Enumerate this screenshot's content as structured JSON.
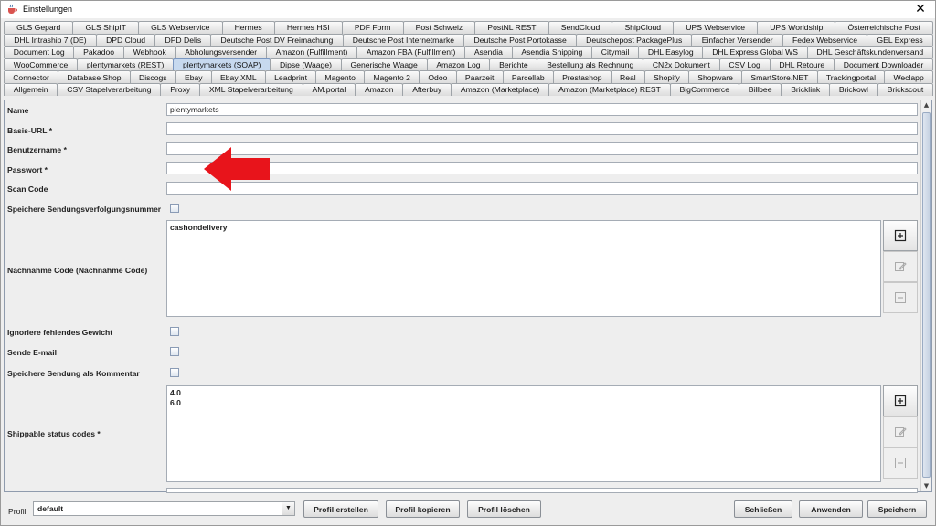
{
  "window": {
    "title": "Einstellungen",
    "close_glyph": "✕",
    "icon": "java-cup-icon"
  },
  "tabs": {
    "rows": [
      [
        "GLS Gepard",
        "GLS ShipIT",
        "GLS Webservice",
        "Hermes",
        "Hermes HSI",
        "PDF Form",
        "Post Schweiz",
        "PostNL REST",
        "SendCloud",
        "ShipCloud",
        "UPS Webservice",
        "UPS Worldship",
        "Österreichische Post"
      ],
      [
        "DHL Intraship 7 (DE)",
        "DPD Cloud",
        "DPD Delis",
        "Deutsche Post DV Freimachung",
        "Deutsche Post Internetmarke",
        "Deutsche Post Portokasse",
        "Deutschepost PackagePlus",
        "Einfacher Versender",
        "Fedex Webservice",
        "GEL Express"
      ],
      [
        "Document Log",
        "Pakadoo",
        "Webhook",
        "Abholungsversender",
        "Amazon (Fulfillment)",
        "Amazon FBA (Fulfillment)",
        "Asendia",
        "Asendia Shipping",
        "Citymail",
        "DHL Easylog",
        "DHL Express Global WS",
        "DHL Geschäftskundenversand"
      ],
      [
        "WooCommerce",
        "plentymarkets (REST)",
        "plentymarkets (SOAP)",
        "Dipse (Waage)",
        "Generische Waage",
        "Amazon Log",
        "Berichte",
        "Bestellung als Rechnung",
        "CN2x Dokument",
        "CSV Log",
        "DHL Retoure",
        "Document Downloader"
      ],
      [
        "Connector",
        "Database Shop",
        "Discogs",
        "Ebay",
        "Ebay XML",
        "Leadprint",
        "Magento",
        "Magento 2",
        "Odoo",
        "Paarzeit",
        "Parcellab",
        "Prestashop",
        "Real",
        "Shopify",
        "Shopware",
        "SmartStore.NET",
        "Trackingportal",
        "Weclapp"
      ],
      [
        "Allgemein",
        "CSV Stapelverarbeitung",
        "Proxy",
        "XML Stapelverarbeitung",
        "AM.portal",
        "Amazon",
        "Afterbuy",
        "Amazon (Marketplace)",
        "Amazon (Marketplace) REST",
        "BigCommerce",
        "Billbee",
        "Bricklink",
        "Brickowl",
        "Brickscout"
      ]
    ],
    "selected": "plentymarkets (SOAP)"
  },
  "form": {
    "name_label": "Name",
    "name_value": "plentymarkets",
    "basis_url_label": "Basis-URL *",
    "basis_url_value": "",
    "benutzername_label": "Benutzername *",
    "benutzername_value": "",
    "passwort_label": "Passwort *",
    "passwort_value": "",
    "scan_code_label": "Scan Code",
    "scan_code_value": "",
    "speichere_tracking_label": "Speichere Sendungsverfolgungsnummer",
    "nachnahme_label": "Nachnahme Code (Nachnahme Code)",
    "nachnahme_items": [
      "cashondelivery"
    ],
    "ignoriere_gewicht_label": "Ignoriere fehlendes Gewicht",
    "sende_email_label": "Sende E-mail",
    "speichere_kommentar_label": "Speichere Sendung als Kommentar",
    "shippable_label": "Shippable status codes *",
    "shippable_items": [
      "4.0",
      "6.0"
    ]
  },
  "footer": {
    "profil_label": "Profil",
    "profil_value": "default",
    "profil_erstellen": "Profil erstellen",
    "profil_kopieren": "Profil kopieren",
    "profil_loeschen": "Profil löschen",
    "schliessen": "Schließen",
    "anwenden": "Anwenden",
    "speichern": "Speichern"
  },
  "colors": {
    "annotation_arrow": "#e8141b",
    "selected_tab": "#c7d9ef"
  }
}
